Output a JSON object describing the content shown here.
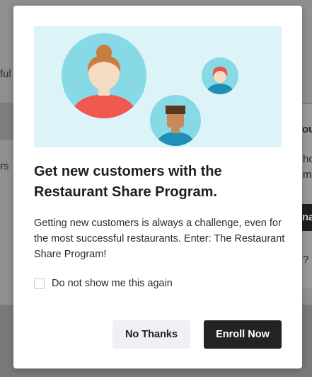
{
  "background": {
    "fragment_1": "ful",
    "fragment_2": "rs",
    "fragment_3": "ou",
    "fragment_4": "ho",
    "fragment_5": "me",
    "fragment_6": "na",
    "fragment_7": "?"
  },
  "modal": {
    "illustration": "customers-illustration",
    "title": "Get new customers with the Restaurant Share Program.",
    "description": "Getting new customers is always a challenge, even for the most successful restaurants. Enter: The Restaurant Share Program!",
    "checkbox_label": "Do not show me this again",
    "checkbox_checked": false,
    "secondary_button": "No Thanks",
    "primary_button": "Enroll Now"
  },
  "colors": {
    "primary_button_bg": "#232323",
    "secondary_button_bg": "#eef0f3",
    "illustration_bg": "#dcf4f8",
    "avatar_circle": "#86d9e5",
    "avatar_shirt_red": "#f0594f",
    "avatar_shirt_blue": "#1f8fb8"
  }
}
